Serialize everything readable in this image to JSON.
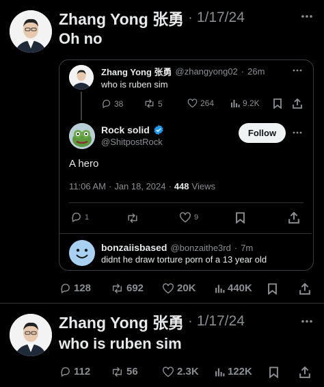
{
  "post1": {
    "author": "Zhang Yong 张勇",
    "dot": "·",
    "date": "1/17/24",
    "text": "Oh no",
    "stats": {
      "replies": "128",
      "reposts": "692",
      "likes": "20K",
      "views": "440K"
    }
  },
  "quote": {
    "tweet": {
      "author": "Zhang Yong 张勇",
      "handle": "@zhangyong02",
      "dot": "·",
      "time": "26m",
      "text": "who is ruben sim",
      "stats": {
        "replies": "38",
        "reposts": "5",
        "likes": "264",
        "views": "9.2K"
      }
    },
    "reply": {
      "author": "Rock solid",
      "handle": "@ShitpostRock",
      "follow_label": "Follow",
      "text": "A hero",
      "time": "11:06 AM",
      "dot": "·",
      "date": "Jan 18, 2024",
      "dot2": "·",
      "views_count": "448",
      "views_label": "Views",
      "stats": {
        "replies": "1",
        "likes": "9"
      }
    },
    "comment": {
      "author": "bonzaiisbased",
      "handle": "@bonzaithe3rd",
      "dot": "·",
      "time": "7m",
      "text": "didnt he draw torture porn of a 13 year old"
    }
  },
  "post2": {
    "author": "Zhang Yong 张勇",
    "dot": "·",
    "date": "1/17/24",
    "text": "who is ruben sim",
    "stats": {
      "replies": "112",
      "reposts": "56",
      "likes": "2.3K",
      "views": "122K"
    }
  },
  "colors": {
    "background": "#000000",
    "text": "#e7e9ea",
    "muted": "#8b8f94",
    "verified": "#1d9bf0"
  }
}
